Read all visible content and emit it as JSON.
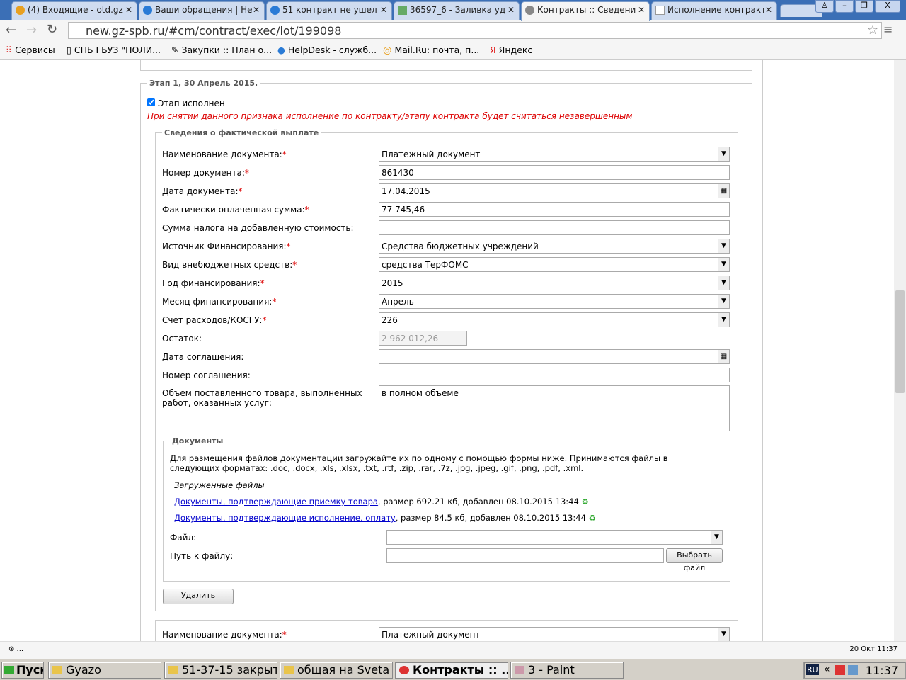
{
  "browser": {
    "tabs": [
      {
        "label": "(4) Входящие - otd.gz"
      },
      {
        "label": "Ваши обращения | Не"
      },
      {
        "label": "51 контракт не ушел"
      },
      {
        "label": "36597_6 - Заливка уд"
      },
      {
        "label": "Контракты :: Сведени",
        "active": true
      },
      {
        "label": "Исполнение контракт"
      }
    ],
    "url": "new.gz-spb.ru/#cm/contract/exec/lot/199098",
    "bookmarks": [
      "Сервисы",
      "СПБ ГБУЗ \"ПОЛИ...",
      "Закупки :: План о...",
      "HelpDesk - служб...",
      "Mail.Ru: почта, п...",
      "Яндекс"
    ]
  },
  "stage": {
    "legend": "Этап 1, 30 Апрель 2015.",
    "done_label": "Этап исполнен",
    "warning": "При снятии данного признака исполнение по контракту/этапу контракта будет считаться незавершенным",
    "payment_legend": "Сведения о фактической выплате",
    "fields": [
      {
        "label": "Наименование документа:",
        "req": "*",
        "value": "Платежный документ",
        "type": "select"
      },
      {
        "label": "Номер документа:",
        "req": "*",
        "value": "861430",
        "type": "text"
      },
      {
        "label": "Дата документа:",
        "req": "*",
        "value": "17.04.2015",
        "type": "date"
      },
      {
        "label": "Фактически оплаченная сумма:",
        "req": "*",
        "value": "77 745,46",
        "type": "text"
      },
      {
        "label": "Сумма налога на добавленную стоимость:",
        "value": "",
        "type": "text"
      },
      {
        "label": "Источник Финансирования:",
        "req": "*",
        "value": "Средства бюджетных учреждений",
        "type": "select"
      },
      {
        "label": "Вид внебюджетных средств:",
        "req": "*",
        "value": "средства ТерФОМС",
        "type": "select"
      },
      {
        "label": "Год финансирования:",
        "req": "*",
        "value": "2015",
        "type": "select"
      },
      {
        "label": "Месяц финансирования:",
        "req": "*",
        "value": "Апрель",
        "type": "select"
      },
      {
        "label": "Счет расходов/КОСГУ:",
        "req": "*",
        "value": "226",
        "type": "select"
      },
      {
        "label": "Остаток:",
        "value": "2 962 012,26",
        "type": "disabled"
      },
      {
        "label": "Дата соглашения:",
        "value": "",
        "type": "date"
      },
      {
        "label": "Номер соглашения:",
        "value": "",
        "type": "text"
      }
    ],
    "volume_label": "Объем поставленного товара, выполненных работ, оказанных услуг:",
    "volume_value": "в полном объеме",
    "docs": {
      "legend": "Документы",
      "info": "Для размещения файлов документации загружайте их по одному с помощью формы ниже. Принимаются файлы в следующих форматах: .doc, .docx, .xls, .xlsx, .txt, .rtf, .zip, .rar, .7z, .jpg, .jpeg, .gif, .png, .pdf, .xml.",
      "uploaded_title": "Загруженные файлы",
      "files": [
        {
          "name": "Документы, подтверждающие приемку товара",
          "meta": ", размер 692.21 кб, добавлен 08.10.2015 13:44"
        },
        {
          "name": "Документы, подтверждающие исполнение, оплату",
          "meta": ", размер 84.5 кб, добавлен 08.10.2015 13:44"
        }
      ],
      "file_label": "Файл:",
      "path_label": "Путь к файлу:",
      "choose_button": "Выбрать файл"
    },
    "delete_button": "Удалить",
    "next_label": "Наименование документа:",
    "next_req": "*",
    "next_value": "Платежный документ"
  },
  "status": {
    "left": "⊗ ...",
    "right": "20 Окт 11:37"
  },
  "taskbar": {
    "start": "Пуск",
    "items": [
      "Gyazo",
      "51-37-15 закрыт",
      "общая на Sveta",
      "Контракты :: ...",
      "3 - Paint"
    ],
    "lang": "RU",
    "clock": "11:37"
  }
}
